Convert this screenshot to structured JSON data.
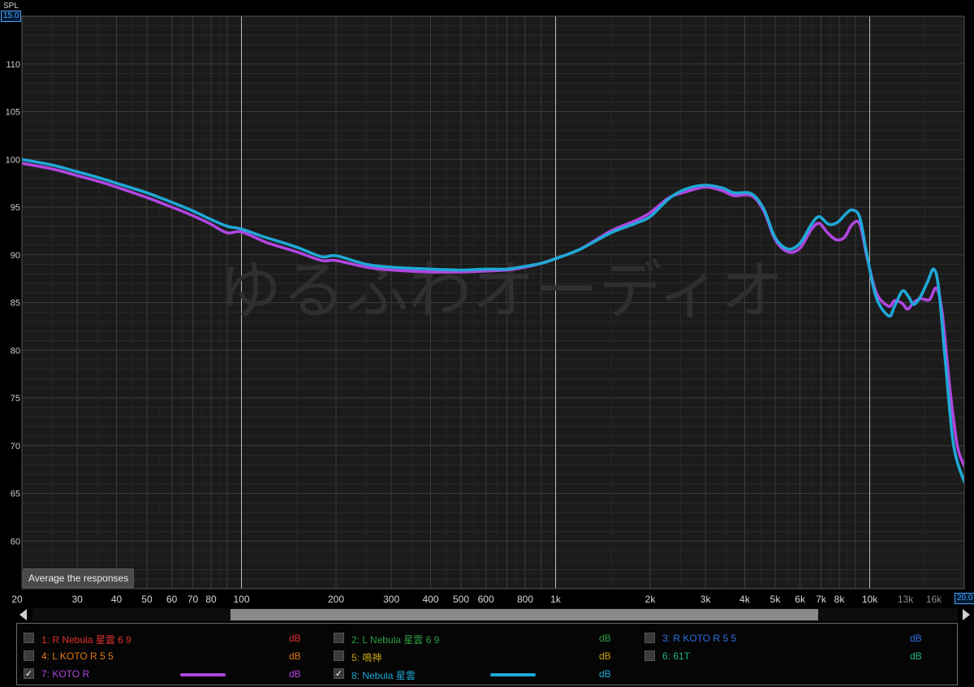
{
  "chart_data": {
    "type": "line",
    "xscale": "log",
    "xlim": [
      20,
      20000
    ],
    "ylim": [
      55,
      115
    ],
    "y_axis_label": "SPL",
    "y_top_value": "15.0",
    "x_end_value": "20.0",
    "yticks": [
      60,
      65,
      70,
      75,
      80,
      85,
      90,
      95,
      100,
      105,
      110
    ],
    "xticks": [
      {
        "value": 20,
        "label": "20"
      },
      {
        "value": 30,
        "label": "30"
      },
      {
        "value": 40,
        "label": "40"
      },
      {
        "value": 50,
        "label": "50"
      },
      {
        "value": 60,
        "label": "60"
      },
      {
        "value": 70,
        "label": "70"
      },
      {
        "value": 80,
        "label": "80"
      },
      {
        "value": 100,
        "label": "100"
      },
      {
        "value": 200,
        "label": "200"
      },
      {
        "value": 300,
        "label": "300"
      },
      {
        "value": 400,
        "label": "400"
      },
      {
        "value": 500,
        "label": "500"
      },
      {
        "value": 600,
        "label": "600"
      },
      {
        "value": 800,
        "label": "800"
      },
      {
        "value": 1000,
        "label": "1k"
      },
      {
        "value": 2000,
        "label": "2k"
      },
      {
        "value": 3000,
        "label": "3k"
      },
      {
        "value": 4000,
        "label": "4k"
      },
      {
        "value": 5000,
        "label": "5k"
      },
      {
        "value": 6000,
        "label": "6k"
      },
      {
        "value": 7000,
        "label": "7k"
      },
      {
        "value": 8000,
        "label": "8k"
      },
      {
        "value": 10000,
        "label": "10k"
      },
      {
        "value": 13000,
        "label": "13k",
        "dim": true
      },
      {
        "value": 16000,
        "label": "16k",
        "dim": true
      }
    ],
    "grid": true,
    "watermark": "ゆるふわオーディオ",
    "series": [
      {
        "name": "7: KOTO R",
        "color": "#b046e0",
        "points": [
          [
            20,
            99.6
          ],
          [
            25,
            99.0
          ],
          [
            30,
            98.3
          ],
          [
            35,
            97.7
          ],
          [
            40,
            97.1
          ],
          [
            50,
            96.0
          ],
          [
            60,
            95.0
          ],
          [
            70,
            94.1
          ],
          [
            80,
            93.2
          ],
          [
            90,
            92.3
          ],
          [
            100,
            92.4
          ],
          [
            120,
            91.3
          ],
          [
            150,
            90.3
          ],
          [
            180,
            89.4
          ],
          [
            200,
            89.4
          ],
          [
            250,
            88.7
          ],
          [
            300,
            88.4
          ],
          [
            400,
            88.2
          ],
          [
            500,
            88.2
          ],
          [
            600,
            88.3
          ],
          [
            700,
            88.4
          ],
          [
            800,
            88.7
          ],
          [
            900,
            89.1
          ],
          [
            1000,
            89.6
          ],
          [
            1200,
            90.6
          ],
          [
            1500,
            92.5
          ],
          [
            1800,
            93.6
          ],
          [
            2000,
            94.4
          ],
          [
            2300,
            96.0
          ],
          [
            2600,
            96.6
          ],
          [
            3000,
            97.1
          ],
          [
            3400,
            96.7
          ],
          [
            3700,
            96.2
          ],
          [
            4200,
            96.2
          ],
          [
            4600,
            94.6
          ],
          [
            5000,
            91.6
          ],
          [
            5500,
            90.3
          ],
          [
            6000,
            90.7
          ],
          [
            6500,
            92.6
          ],
          [
            6900,
            93.3
          ],
          [
            7300,
            92.4
          ],
          [
            7800,
            91.6
          ],
          [
            8300,
            91.8
          ],
          [
            8800,
            93.2
          ],
          [
            9300,
            93.2
          ],
          [
            9800,
            89.8
          ],
          [
            10500,
            86.0
          ],
          [
            11500,
            84.6
          ],
          [
            12000,
            85.2
          ],
          [
            12700,
            84.9
          ],
          [
            13200,
            84.3
          ],
          [
            13800,
            85.0
          ],
          [
            14500,
            85.4
          ],
          [
            15500,
            85.3
          ],
          [
            16300,
            86.5
          ],
          [
            17000,
            84.0
          ],
          [
            18000,
            76.0
          ],
          [
            19000,
            70.0
          ],
          [
            20000,
            67.9
          ]
        ]
      },
      {
        "name": "8: Nebula 星雲",
        "color": "#1fa8d6",
        "points": [
          [
            20,
            100.0
          ],
          [
            25,
            99.4
          ],
          [
            30,
            98.7
          ],
          [
            35,
            98.1
          ],
          [
            40,
            97.5
          ],
          [
            50,
            96.5
          ],
          [
            60,
            95.5
          ],
          [
            70,
            94.6
          ],
          [
            80,
            93.7
          ],
          [
            90,
            93.0
          ],
          [
            100,
            92.7
          ],
          [
            120,
            91.8
          ],
          [
            150,
            90.8
          ],
          [
            180,
            89.8
          ],
          [
            200,
            89.9
          ],
          [
            250,
            89.0
          ],
          [
            300,
            88.7
          ],
          [
            400,
            88.5
          ],
          [
            500,
            88.4
          ],
          [
            600,
            88.5
          ],
          [
            700,
            88.5
          ],
          [
            800,
            88.8
          ],
          [
            900,
            89.1
          ],
          [
            1000,
            89.6
          ],
          [
            1200,
            90.6
          ],
          [
            1500,
            92.3
          ],
          [
            1800,
            93.3
          ],
          [
            2000,
            94.0
          ],
          [
            2300,
            95.9
          ],
          [
            2600,
            96.9
          ],
          [
            3000,
            97.3
          ],
          [
            3400,
            97.0
          ],
          [
            3700,
            96.5
          ],
          [
            4200,
            96.4
          ],
          [
            4600,
            94.8
          ],
          [
            5000,
            91.8
          ],
          [
            5500,
            90.6
          ],
          [
            6000,
            91.2
          ],
          [
            6500,
            93.1
          ],
          [
            6900,
            94.0
          ],
          [
            7400,
            93.2
          ],
          [
            7900,
            93.4
          ],
          [
            8400,
            94.3
          ],
          [
            8800,
            94.7
          ],
          [
            9300,
            93.9
          ],
          [
            9800,
            90.0
          ],
          [
            10500,
            85.5
          ],
          [
            11500,
            83.6
          ],
          [
            12000,
            84.6
          ],
          [
            12700,
            86.2
          ],
          [
            13300,
            85.6
          ],
          [
            13800,
            84.8
          ],
          [
            14500,
            85.6
          ],
          [
            15300,
            87.2
          ],
          [
            16000,
            88.5
          ],
          [
            16600,
            86.3
          ],
          [
            17500,
            78.0
          ],
          [
            18500,
            70.0
          ],
          [
            20000,
            66.2
          ]
        ]
      }
    ]
  },
  "ui": {
    "average_button": "Average the responses"
  },
  "legend": {
    "items": [
      {
        "name": "1: R Nebula 星雲 6 9",
        "unit": "dB",
        "checked": false,
        "color": "#e03030",
        "line": false
      },
      {
        "name": "2: L Nebula 星雲 6 9",
        "unit": "dB",
        "checked": false,
        "color": "#2ea043",
        "line": false
      },
      {
        "name": "3: R KOTO R 5 5",
        "unit": "dB",
        "checked": false,
        "color": "#2f6fe0",
        "line": false
      },
      {
        "name": "4: L KOTO R 5 5",
        "unit": "dB",
        "checked": false,
        "color": "#e07a18",
        "line": false
      },
      {
        "name": "5: 鳴神",
        "unit": "dB",
        "checked": false,
        "color": "#c8a415",
        "line": false
      },
      {
        "name": "6: 61T",
        "unit": "dB",
        "checked": false,
        "color": "#1fb583",
        "line": false
      },
      {
        "name": "7: KOTO R",
        "unit": "dB",
        "checked": true,
        "color": "#b046e0",
        "line": true
      },
      {
        "name": "8: Nebula 星雲",
        "unit": "dB",
        "checked": true,
        "color": "#1fa8d6",
        "line": true
      }
    ]
  }
}
